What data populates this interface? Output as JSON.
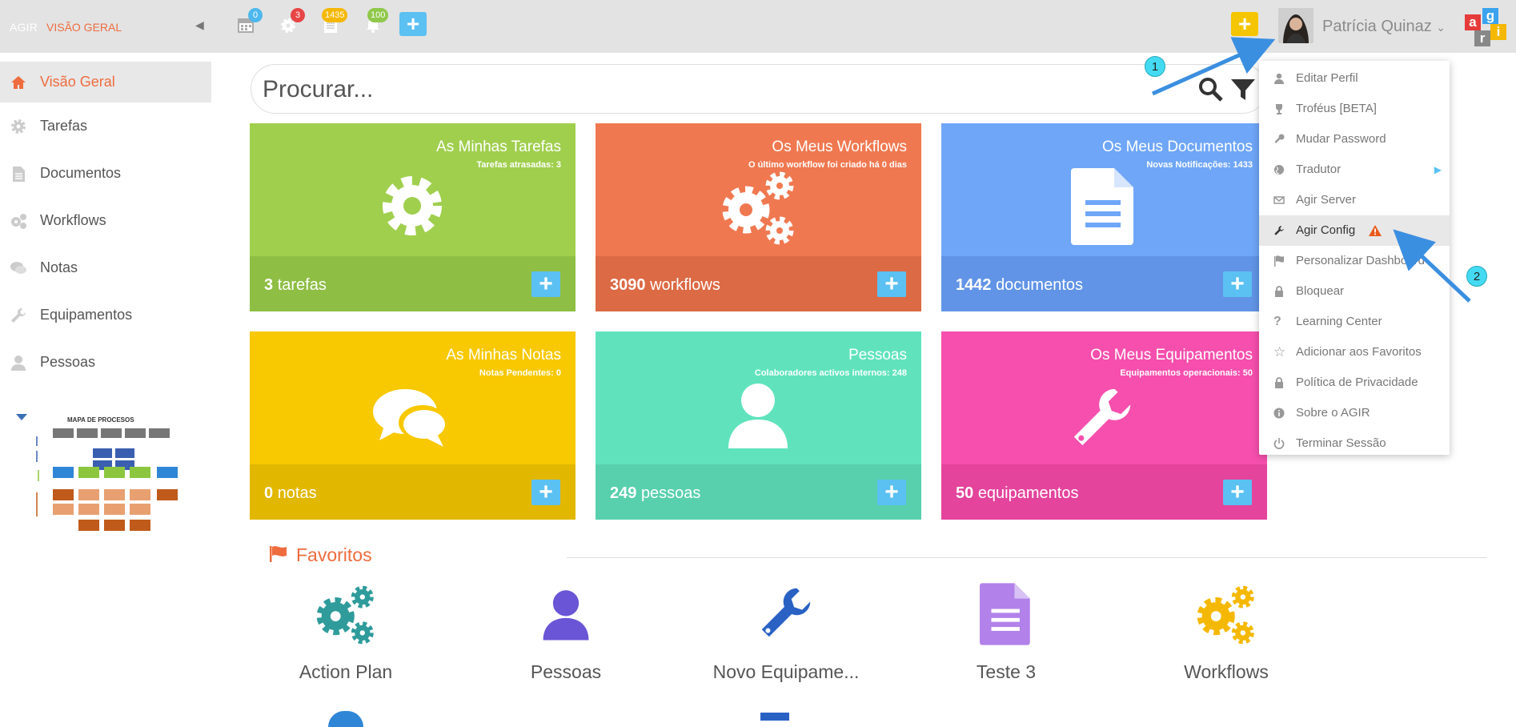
{
  "header": {
    "brand": "AGIR",
    "page": "VISÃO GERAL",
    "badges": {
      "calendar": "0",
      "tasks": "3",
      "documents": "1435",
      "notifications": "100"
    },
    "user_name": "Patrícia Quinaz",
    "logo_letters": [
      "a",
      "g",
      "r",
      "i"
    ]
  },
  "sidebar": {
    "items": [
      {
        "label": "Visão Geral",
        "icon": "home-icon"
      },
      {
        "label": "Tarefas",
        "icon": "gear-icon"
      },
      {
        "label": "Documentos",
        "icon": "document-icon"
      },
      {
        "label": "Workflows",
        "icon": "gears-icon"
      },
      {
        "label": "Notas",
        "icon": "chat-icon"
      },
      {
        "label": "Equipamentos",
        "icon": "wrench-icon"
      },
      {
        "label": "Pessoas",
        "icon": "person-icon"
      }
    ],
    "process_map_title": "MAPA DE PROCESOS"
  },
  "search": {
    "placeholder": "Procurar..."
  },
  "tiles": [
    {
      "title": "As Minhas Tarefas",
      "sub": "Tarefas atrasadas: 3",
      "count": "3",
      "unit": "tarefas",
      "color": "#a0cf4e",
      "footer": "#8ebe44"
    },
    {
      "title": "Os Meus Workflows",
      "sub": "O último workflow foi criado há 0 dias",
      "count": "3090",
      "unit": "workflows",
      "color": "#f07850",
      "footer": "#dc6a45"
    },
    {
      "title": "Os Meus Documentos",
      "sub": "Novas Notificações: 1433",
      "count": "1442",
      "unit": "documentos",
      "color": "#6fa6f8",
      "footer": "#6194e6"
    },
    {
      "title": "As Minhas Notas",
      "sub": "Notas Pendentes: 0",
      "count": "0",
      "unit": "notas",
      "color": "#f8c800",
      "footer": "#e2b700"
    },
    {
      "title": "Pessoas",
      "sub": "Colaboradores activos internos: 248",
      "count": "249",
      "unit": "pessoas",
      "color": "#60e3bd",
      "footer": "#58d0ad"
    },
    {
      "title": "Os Meus Equipamentos",
      "sub": "Equipamentos operacionais: 50",
      "count": "50",
      "unit": "equipamentos",
      "color": "#f64fad",
      "footer": "#e4449c"
    }
  ],
  "favorites": {
    "heading": "Favoritos",
    "items": [
      {
        "label": "Action Plan",
        "icon": "gears-icon",
        "color": "#2f9b9b"
      },
      {
        "label": "Pessoas",
        "icon": "person-icon",
        "color": "#6a55d6"
      },
      {
        "label": "Novo Equipame...",
        "icon": "wrench-icon",
        "color": "#2a62c4"
      },
      {
        "label": "Teste 3",
        "icon": "document-icon",
        "color": "#b282ea"
      },
      {
        "label": "Workflows",
        "icon": "gears-icon",
        "color": "#f5b800"
      }
    ]
  },
  "menu": {
    "items": [
      {
        "label": "Editar Perfil",
        "icon": "user-icon"
      },
      {
        "label": "Troféus [BETA]",
        "icon": "trophy-icon"
      },
      {
        "label": "Mudar Password",
        "icon": "key-icon"
      },
      {
        "label": "Tradutor",
        "icon": "globe-icon"
      },
      {
        "label": "Agir Server",
        "icon": "envelope-icon"
      },
      {
        "label": "Agir Config",
        "icon": "wrench-icon"
      },
      {
        "label": "Personalizar Dashboard",
        "icon": "flag-icon"
      },
      {
        "label": "Bloquear",
        "icon": "lock-icon"
      },
      {
        "label": "Learning Center",
        "icon": "question-icon"
      },
      {
        "label": "Adicionar aos Favoritos",
        "icon": "star-icon"
      },
      {
        "label": "Política de Privacidade",
        "icon": "lock-icon"
      },
      {
        "label": "Sobre o AGIR",
        "icon": "info-icon"
      },
      {
        "label": "Terminar Sessão",
        "icon": "power-icon"
      }
    ]
  },
  "callouts": [
    "1",
    "2"
  ]
}
